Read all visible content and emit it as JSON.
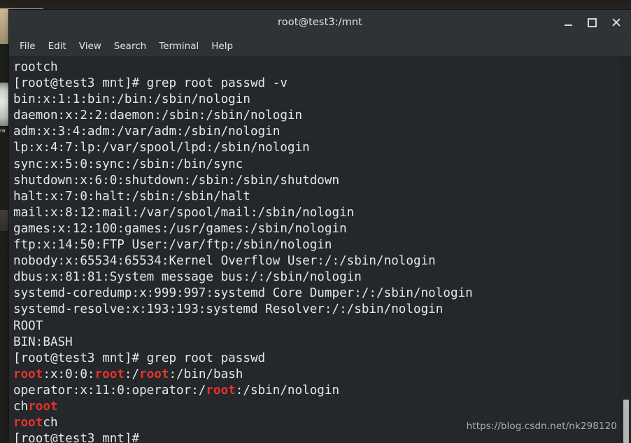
{
  "desktop": {
    "icon_label": "ra"
  },
  "window": {
    "title": "root@test3:/mnt",
    "controls": {
      "minimize": "minimize-button",
      "maximize": "maximize-button",
      "close": "close-button"
    }
  },
  "menubar": {
    "items": [
      {
        "label": "File"
      },
      {
        "label": "Edit"
      },
      {
        "label": "View"
      },
      {
        "label": "Search"
      },
      {
        "label": "Terminal"
      },
      {
        "label": "Help"
      }
    ]
  },
  "terminal": {
    "prompt": "[root@test3 mnt]# ",
    "match_color": "#e8322c",
    "foreground": "#e6e6e6",
    "background": "#24282a",
    "lines": [
      {
        "segments": [
          {
            "t": "rootch",
            "m": false
          }
        ]
      },
      {
        "segments": [
          {
            "t": "[root@test3 mnt]# grep root passwd -v",
            "m": false
          }
        ]
      },
      {
        "segments": [
          {
            "t": "bin:x:1:1:bin:/bin:/sbin/nologin",
            "m": false
          }
        ]
      },
      {
        "segments": [
          {
            "t": "daemon:x:2:2:daemon:/sbin:/sbin/nologin",
            "m": false
          }
        ]
      },
      {
        "segments": [
          {
            "t": "adm:x:3:4:adm:/var/adm:/sbin/nologin",
            "m": false
          }
        ]
      },
      {
        "segments": [
          {
            "t": "lp:x:4:7:lp:/var/spool/lpd:/sbin/nologin",
            "m": false
          }
        ]
      },
      {
        "segments": [
          {
            "t": "sync:x:5:0:sync:/sbin:/bin/sync",
            "m": false
          }
        ]
      },
      {
        "segments": [
          {
            "t": "shutdown:x:6:0:shutdown:/sbin:/sbin/shutdown",
            "m": false
          }
        ]
      },
      {
        "segments": [
          {
            "t": "halt:x:7:0:halt:/sbin:/sbin/halt",
            "m": false
          }
        ]
      },
      {
        "segments": [
          {
            "t": "mail:x:8:12:mail:/var/spool/mail:/sbin/nologin",
            "m": false
          }
        ]
      },
      {
        "segments": [
          {
            "t": "games:x:12:100:games:/usr/games:/sbin/nologin",
            "m": false
          }
        ]
      },
      {
        "segments": [
          {
            "t": "ftp:x:14:50:FTP User:/var/ftp:/sbin/nologin",
            "m": false
          }
        ]
      },
      {
        "segments": [
          {
            "t": "nobody:x:65534:65534:Kernel Overflow User:/:/sbin/nologin",
            "m": false
          }
        ]
      },
      {
        "segments": [
          {
            "t": "dbus:x:81:81:System message bus:/:/sbin/nologin",
            "m": false
          }
        ]
      },
      {
        "segments": [
          {
            "t": "systemd-coredump:x:999:997:systemd Core Dumper:/:/sbin/nologin",
            "m": false
          }
        ]
      },
      {
        "segments": [
          {
            "t": "systemd-resolve:x:193:193:systemd Resolver:/:/sbin/nologin",
            "m": false
          }
        ]
      },
      {
        "segments": [
          {
            "t": "ROOT",
            "m": false
          }
        ]
      },
      {
        "segments": [
          {
            "t": "BIN:BASH",
            "m": false
          }
        ]
      },
      {
        "segments": [
          {
            "t": "[root@test3 mnt]# grep root passwd",
            "m": false
          }
        ]
      },
      {
        "segments": [
          {
            "t": "root",
            "m": true
          },
          {
            "t": ":x:0:0:",
            "m": false
          },
          {
            "t": "root",
            "m": true
          },
          {
            "t": ":/",
            "m": false
          },
          {
            "t": "root",
            "m": true
          },
          {
            "t": ":/bin/bash",
            "m": false
          }
        ]
      },
      {
        "segments": [
          {
            "t": "operator:x:11:0:operator:/",
            "m": false
          },
          {
            "t": "root",
            "m": true
          },
          {
            "t": ":/sbin/nologin",
            "m": false
          }
        ]
      },
      {
        "segments": [
          {
            "t": "ch",
            "m": false
          },
          {
            "t": "root",
            "m": true
          }
        ]
      },
      {
        "segments": [
          {
            "t": "root",
            "m": true
          },
          {
            "t": "ch",
            "m": false
          }
        ]
      },
      {
        "segments": [
          {
            "t": "[root@test3 mnt]#",
            "m": false
          }
        ]
      }
    ]
  },
  "watermark": {
    "text": "https://blog.csdn.net/nk298120"
  }
}
